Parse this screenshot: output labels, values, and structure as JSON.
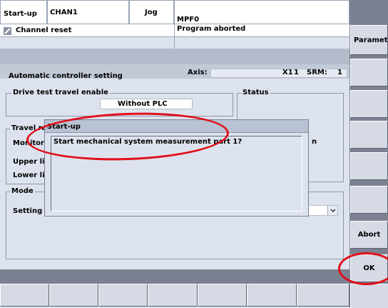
{
  "header": {
    "mode": "Start-up",
    "channel": "CHAN1",
    "op_mode": "Jog",
    "program": "MPF0",
    "channel_status": "Channel reset",
    "program_status": "Program aborted"
  },
  "section": {
    "title": "Automatic controller setting",
    "axis_label": "Axis:",
    "axis_value": "X1",
    "axis_number": "1",
    "srm_label": "SRM:",
    "srm_value": "1"
  },
  "drive_test": {
    "title": "Drive test travel enable",
    "value": "Without PLC"
  },
  "status": {
    "title": "Status"
  },
  "travel": {
    "title_partial": "Travel ra",
    "monitoring_partial": "Monitorin",
    "upper_partial": "Upper lim",
    "lower_partial": "Lower lim",
    "right_partial": "n"
  },
  "mode": {
    "title": "Mode",
    "setting_partial": "Setting m"
  },
  "dialog": {
    "title": "Start-up",
    "message": "Start mechanical system measurement part 1?"
  },
  "softkeys": {
    "right": [
      "Paramete",
      "",
      "",
      "",
      "",
      "",
      "",
      "Abort",
      "OK"
    ]
  },
  "annotations": {
    "highlight_color": "#e0101a"
  }
}
